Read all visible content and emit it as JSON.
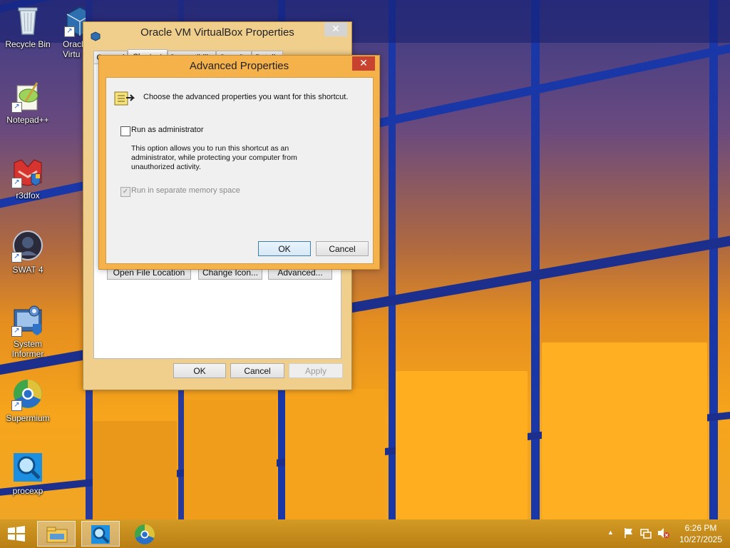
{
  "desktop": {
    "icons": [
      {
        "label": "Recycle Bin",
        "icon": "recycle-bin-icon",
        "shortcut": false
      },
      {
        "label": "Oracle VM VirtualBox",
        "icon": "virtualbox-icon",
        "shortcut": true
      },
      {
        "label": "Notepad++",
        "icon": "notepadpp-icon",
        "shortcut": true
      },
      {
        "label": "r3dfox",
        "icon": "r3dfox-icon",
        "shortcut": true
      },
      {
        "label": "SWAT 4",
        "icon": "swat4-icon",
        "shortcut": true
      },
      {
        "label": "System Informer",
        "icon": "system-informer-icon",
        "shortcut": true
      },
      {
        "label": "Supermium",
        "icon": "supermium-icon",
        "shortcut": true
      },
      {
        "label": "procexp",
        "icon": "procexp-icon",
        "shortcut": false
      }
    ],
    "partial_label_line1": "Oracl",
    "partial_label_line2": "Virtu"
  },
  "properties_window": {
    "title": "Oracle VM VirtualBox Properties",
    "tabs": [
      "General",
      "Shortcut",
      "Compatibility",
      "Security",
      "Details"
    ],
    "buttons": {
      "open_file_location": "Open File Location",
      "change_icon": "Change Icon...",
      "advanced": "Advanced..."
    },
    "footer": {
      "ok": "OK",
      "cancel": "Cancel",
      "apply": "Apply"
    }
  },
  "advanced_dialog": {
    "title": "Advanced Properties",
    "close": "✕",
    "header_text": "Choose the advanced properties you want for this shortcut.",
    "run_as_admin_label": "Run as administrator",
    "run_as_admin_checked": false,
    "description": "This option allows you to run this shortcut as an administrator, while protecting your computer from unauthorized activity.",
    "separate_memory_label": "Run in separate memory space",
    "separate_memory_checked": true,
    "ok": "OK",
    "cancel": "Cancel"
  },
  "taskbar": {
    "clock_time": "6:26 PM",
    "clock_date": "10/27/2025",
    "pinned": [
      "file-explorer-icon",
      "procexp-icon",
      "supermium-icon"
    ]
  },
  "colors": {
    "accent_orange": "#f6b24a",
    "close_red": "#c7432f",
    "wallpaper_blue": "#1a37a8"
  }
}
